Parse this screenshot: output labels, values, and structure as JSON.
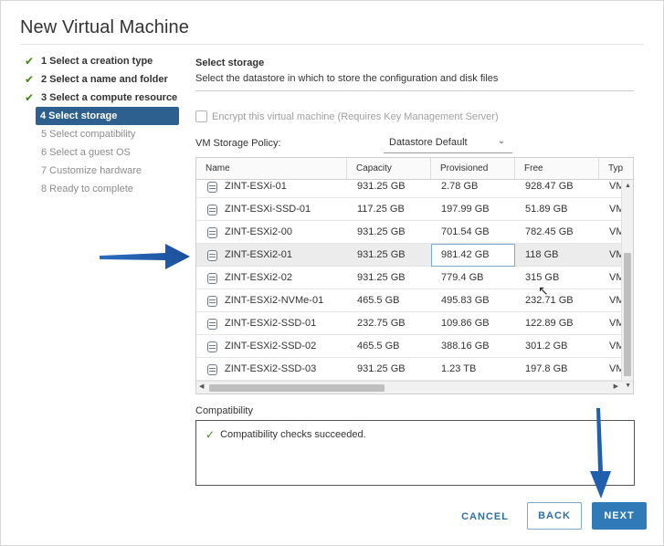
{
  "dialog": {
    "title": "New Virtual Machine"
  },
  "steps": [
    {
      "label": "1 Select a creation type",
      "state": "done"
    },
    {
      "label": "2 Select a name and folder",
      "state": "done"
    },
    {
      "label": "3 Select a compute resource",
      "state": "done"
    },
    {
      "label": "4 Select storage",
      "state": "active"
    },
    {
      "label": "5 Select compatibility",
      "state": "future"
    },
    {
      "label": "6 Select a guest OS",
      "state": "future"
    },
    {
      "label": "7 Customize hardware",
      "state": "future"
    },
    {
      "label": "8 Ready to complete",
      "state": "future"
    }
  ],
  "main": {
    "title": "Select storage",
    "description": "Select the datastore in which to store the configuration and disk files",
    "encrypt_label": "Encrypt this virtual machine (Requires Key Management Server)",
    "policy_label": "VM Storage Policy:",
    "policy_value": "Datastore Default"
  },
  "grid": {
    "columns": [
      "Name",
      "Capacity",
      "Provisioned",
      "Free",
      "Typ"
    ],
    "rows": [
      {
        "name": "ZINT-ESXi-01",
        "capacity": "931.25 GB",
        "provisioned": "2.78 GB",
        "free": "928.47 GB",
        "type": "VM"
      },
      {
        "name": "ZINT-ESXi-SSD-01",
        "capacity": "117.25 GB",
        "provisioned": "197.99 GB",
        "free": "51.89 GB",
        "type": "VM"
      },
      {
        "name": "ZINT-ESXi2-00",
        "capacity": "931.25 GB",
        "provisioned": "701.54 GB",
        "free": "782.45 GB",
        "type": "VM"
      },
      {
        "name": "ZINT-ESXi2-01",
        "capacity": "931.25 GB",
        "provisioned": "981.42 GB",
        "free": "118 GB",
        "type": "VM"
      },
      {
        "name": "ZINT-ESXi2-02",
        "capacity": "931.25 GB",
        "provisioned": "779.4 GB",
        "free": "315 GB",
        "type": "VM"
      },
      {
        "name": "ZINT-ESXi2-NVMe-01",
        "capacity": "465.5 GB",
        "provisioned": "495.83 GB",
        "free": "232.71 GB",
        "type": "VM"
      },
      {
        "name": "ZINT-ESXi2-SSD-01",
        "capacity": "232.75 GB",
        "provisioned": "109.86 GB",
        "free": "122.89 GB",
        "type": "VM"
      },
      {
        "name": "ZINT-ESXi2-SSD-02",
        "capacity": "465.5 GB",
        "provisioned": "388.16 GB",
        "free": "301.2 GB",
        "type": "VM"
      },
      {
        "name": "ZINT-ESXi2-SSD-03",
        "capacity": "931.25 GB",
        "provisioned": "1.23 TB",
        "free": "197.8 GB",
        "type": "VM"
      }
    ],
    "selected_row": 3
  },
  "compatibility": {
    "label": "Compatibility",
    "message": "Compatibility checks succeeded."
  },
  "footer": {
    "cancel": "CANCEL",
    "back": "BACK",
    "next": "NEXT"
  },
  "colors": {
    "accent": "#2f7ab7",
    "active_step": "#2d5f8f",
    "success": "#3f8a0a",
    "annotation_arrow": "#1f5fae"
  }
}
